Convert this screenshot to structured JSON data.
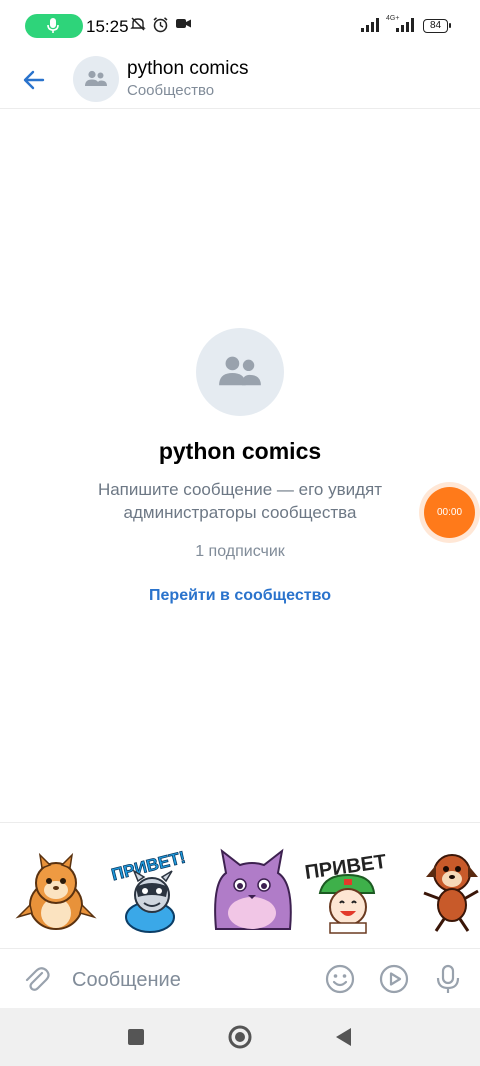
{
  "status_bar": {
    "time": "15:25",
    "network": "4G+",
    "battery": "84",
    "icons": [
      "mic-icon",
      "mute-icon",
      "alarm-icon",
      "video-icon",
      "signal-icon",
      "signal-icon"
    ]
  },
  "header": {
    "title": "python comics",
    "subtitle": "Сообщество"
  },
  "empty_state": {
    "title": "python comics",
    "description": "Напишите сообщение — его увидят администраторы сообщества",
    "subscribers": "1 подписчик",
    "link": "Перейти в сообщество"
  },
  "recording": {
    "timer": "00:00"
  },
  "stickers": [
    {
      "name": "chipmunk-sticker",
      "caption": ""
    },
    {
      "name": "raccoon-privet-sticker",
      "caption": "ПРИВЕТ!"
    },
    {
      "name": "purple-cat-sticker",
      "caption": ""
    },
    {
      "name": "kid-privet-sticker",
      "caption": "ПРИВЕТ"
    },
    {
      "name": "dog-sticker",
      "caption": ""
    }
  ],
  "composer": {
    "placeholder": "Сообщение"
  },
  "colors": {
    "accent": "#2a73cc",
    "mic_pill": "#2ed47a",
    "record": "#ff7a1a",
    "avatar_bg": "#e5ebf1",
    "secondary_text": "#818c99"
  }
}
